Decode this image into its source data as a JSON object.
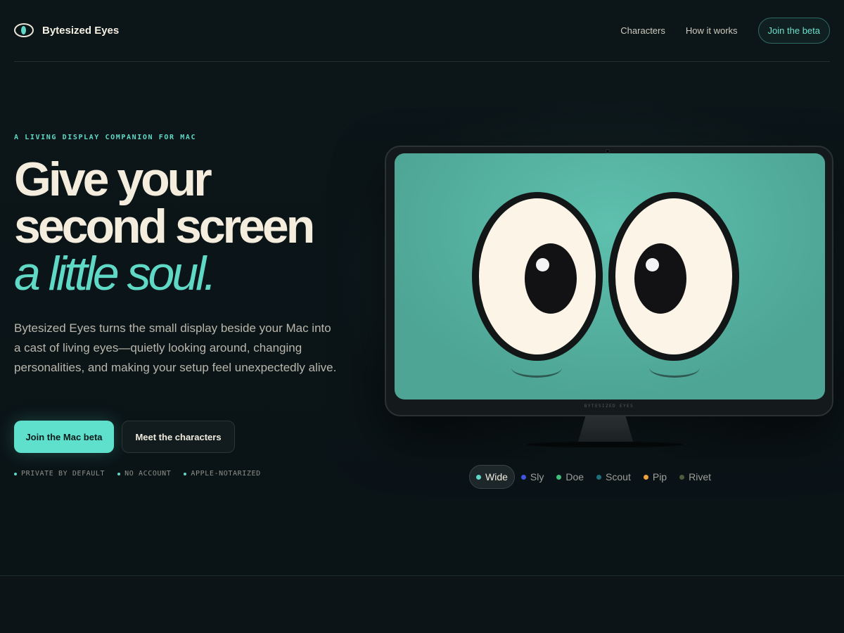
{
  "brand": {
    "name": "Bytesized Eyes"
  },
  "nav": {
    "links": [
      "Characters",
      "How it works"
    ],
    "cta": "Join the beta"
  },
  "hero": {
    "eyebrow": "A LIVING DISPLAY COMPANION FOR MAC",
    "headline_line1": "Give your",
    "headline_line2": "second screen",
    "headline_accent": "a little soul.",
    "lede": "Bytesized Eyes turns the small display beside your Mac into a cast of living eyes—quietly looking around, changing personalities, and making your setup feel unexpectedly alive.",
    "primary_cta": "Join the Mac beta",
    "secondary_cta": "Meet the characters",
    "trust": [
      "PRIVATE BY DEFAULT",
      "NO ACCOUNT",
      "APPLE-NOTARIZED"
    ]
  },
  "monitor": {
    "label": "BYTESIZED EYES"
  },
  "characters": {
    "selected": "Wide",
    "items": [
      {
        "name": "Wide",
        "color": "#5fd8c6"
      },
      {
        "name": "Sly",
        "color": "#3f55e0"
      },
      {
        "name": "Doe",
        "color": "#3fbf7a"
      },
      {
        "name": "Scout",
        "color": "#1f6e7e"
      },
      {
        "name": "Pip",
        "color": "#f0a23e"
      },
      {
        "name": "Rivet",
        "color": "#4f5a3a"
      }
    ]
  },
  "colors": {
    "accent": "#5fd8c6",
    "background": "#0b1417",
    "screen": "#56b3a2"
  }
}
